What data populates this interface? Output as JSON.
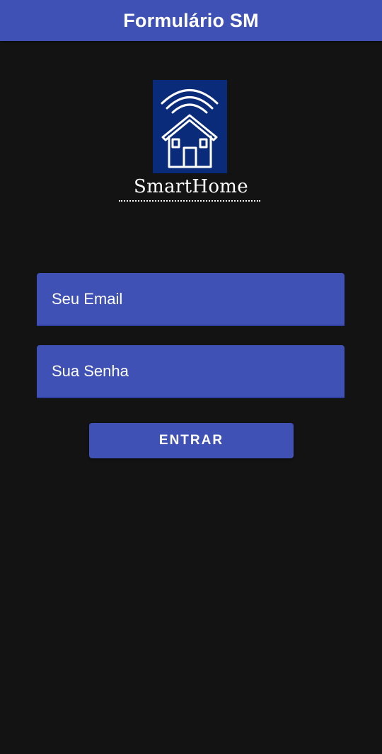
{
  "app_bar": {
    "title": "Formulário SM",
    "color": "#3f51b5"
  },
  "logo": {
    "icon": "smart-home-wifi-icon",
    "text": "SmartHome",
    "background_color": "#0a2a7a"
  },
  "form": {
    "email_placeholder": "Seu Email",
    "password_placeholder": "Sua Senha",
    "submit_label": "ENTRAR"
  },
  "colors": {
    "background": "#131313",
    "primary": "#3f51b5",
    "text": "#ffffff"
  }
}
